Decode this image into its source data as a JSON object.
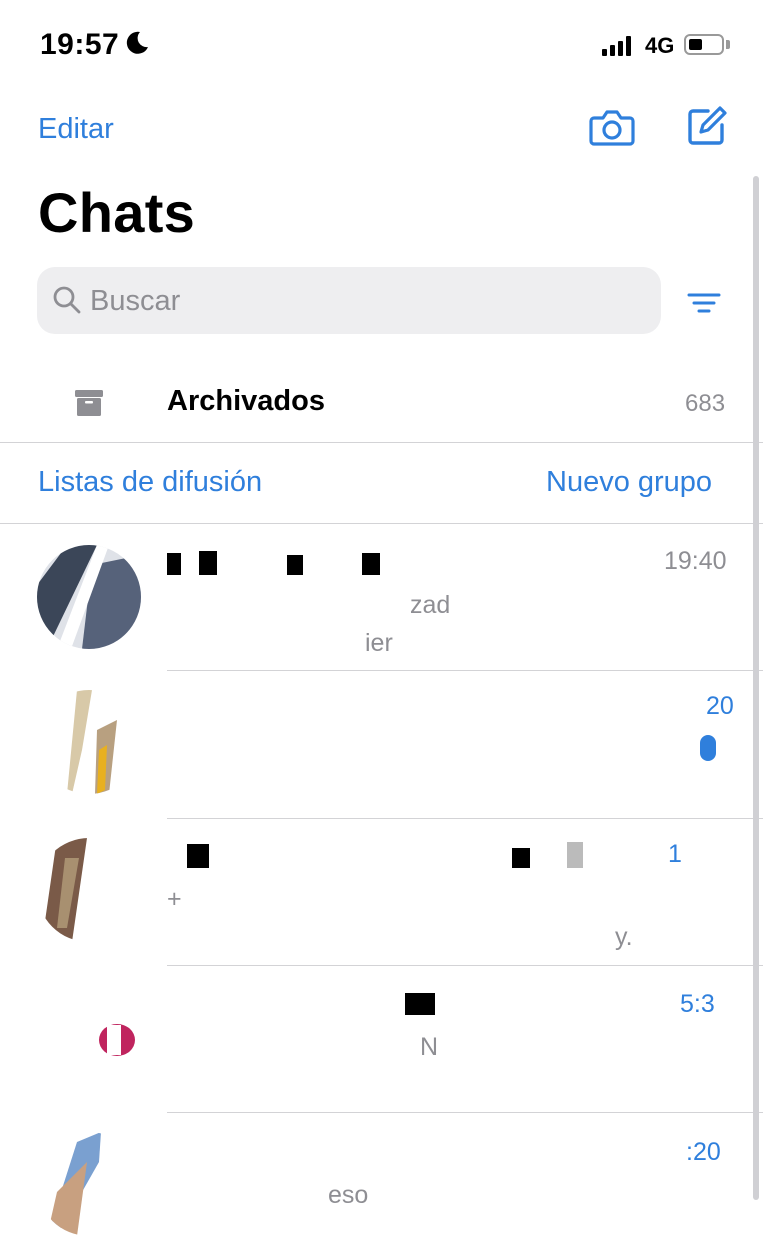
{
  "status_bar": {
    "time": "19:57",
    "network": "4G",
    "icons": [
      "moon-icon",
      "signal-icon",
      "battery-icon"
    ]
  },
  "nav": {
    "edit_label": "Editar",
    "title": "Chats",
    "icons": [
      "camera-icon",
      "compose-icon",
      "filter-icon"
    ]
  },
  "search": {
    "placeholder": "Buscar",
    "icon": "search-icon"
  },
  "archived": {
    "label": "Archivados",
    "count": "683",
    "icon": "archive-box-icon"
  },
  "links": {
    "broadcast_label": "Listas de difusión",
    "new_group_label": "Nuevo grupo"
  },
  "chats": [
    {
      "time": "19:40",
      "preview_1": "zad",
      "preview_2": "ier"
    },
    {
      "time": "20",
      "preview_1": "",
      "preview_2": ""
    },
    {
      "time": "1",
      "preview_1": "+",
      "preview_2": "y."
    },
    {
      "time": "5:3",
      "preview_1": "N",
      "preview_2": ""
    },
    {
      "time": ":20",
      "preview_1": "eso",
      "preview_2": ""
    }
  ],
  "colors": {
    "accent": "#2f7fdc",
    "secondary_text": "#8e8e93",
    "search_bg": "#eeeef0",
    "separator": "#d3d3d6"
  }
}
